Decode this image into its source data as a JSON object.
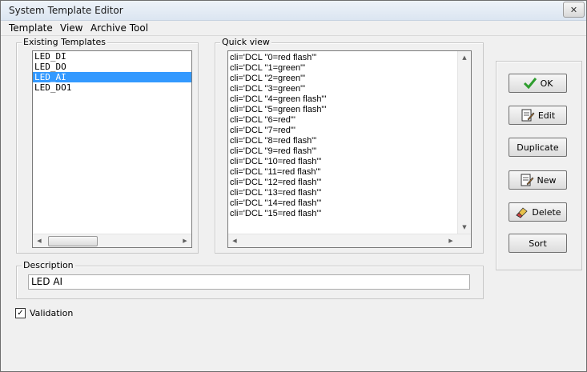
{
  "window": {
    "title": "System Template Editor",
    "close_glyph": "✕"
  },
  "menu": [
    "Template",
    "View",
    "Archive Tool"
  ],
  "existing_templates": {
    "label": "Existing Templates",
    "items": [
      "LED_DI",
      "LED_DO",
      "LED_AI",
      "LED_DO1"
    ],
    "selected_index": 2
  },
  "quick_view": {
    "label": "Quick view",
    "lines": [
      "cli='DCL \"0=red flash\"'",
      "cli='DCL \"1=green\"'",
      "cli='DCL \"2=green\"'",
      "cli='DCL \"3=green\"'",
      "cli='DCL \"4=green flash\"'",
      "cli='DCL \"5=green flash\"'",
      "cli='DCL \"6=red\"'",
      "cli='DCL \"7=red\"'",
      "cli='DCL \"8=red flash\"'",
      "cli='DCL \"9=red flash\"'",
      "cli='DCL \"10=red flash\"'",
      "cli='DCL \"11=red flash\"'",
      "cli='DCL \"12=red flash\"'",
      "cli='DCL \"13=red flash\"'",
      "cli='DCL \"14=red flash\"'",
      "cli='DCL \"15=red flash\"'"
    ]
  },
  "buttons": {
    "ok": "OK",
    "edit": "Edit",
    "duplicate": "Duplicate",
    "new": "New",
    "delete": "Delete",
    "sort": "Sort"
  },
  "description": {
    "label": "Description",
    "value": "LED AI"
  },
  "validation": {
    "label": "Validation",
    "checked": true,
    "mark": "✓"
  },
  "colors": {
    "selection": "#3399ff",
    "ok_check": "#2e9d2e"
  },
  "icons": {
    "ok": "checkmark-icon",
    "edit": "edit-document-icon",
    "new": "new-document-icon",
    "delete": "eraser-icon"
  }
}
